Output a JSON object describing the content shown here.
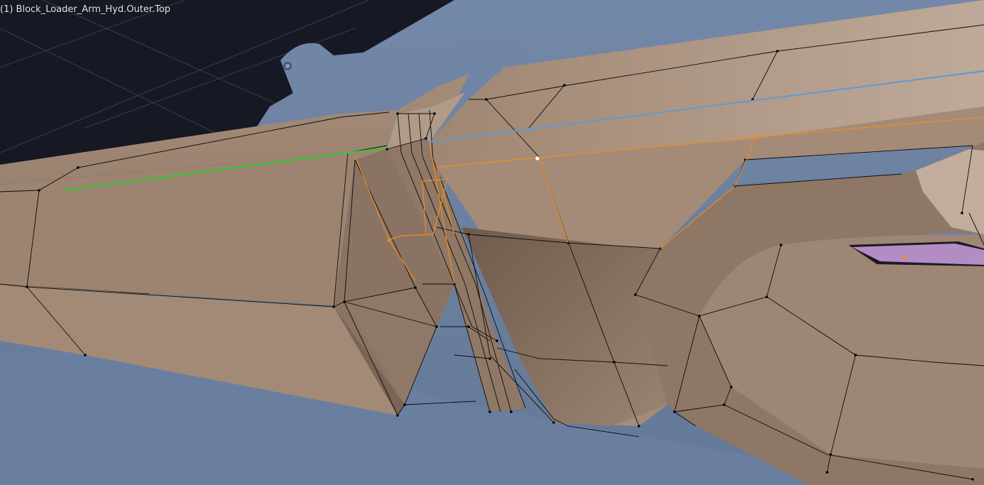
{
  "viewport": {
    "object_label": "(1) Block_Loader_Arm_Hyd.Outer.Top",
    "overlay_info_cropped": "",
    "mode": "Edit Mode",
    "colors": {
      "background": "#161823",
      "grid": "#3a3d4c",
      "background_part": "#6b7d9c",
      "background_part_dark": "#52627e",
      "mesh_base": "#9d8571",
      "mesh_light": "#bba493",
      "mesh_shadow": "#5a4a3e",
      "wire": "#0b0b0b",
      "selected_edge": "#f08c1e",
      "active_vertex": "#ffffff",
      "seam_green": "#2cd12c",
      "seam_blue": "#5b9bd5",
      "selected_face": "#b48cc4"
    }
  }
}
